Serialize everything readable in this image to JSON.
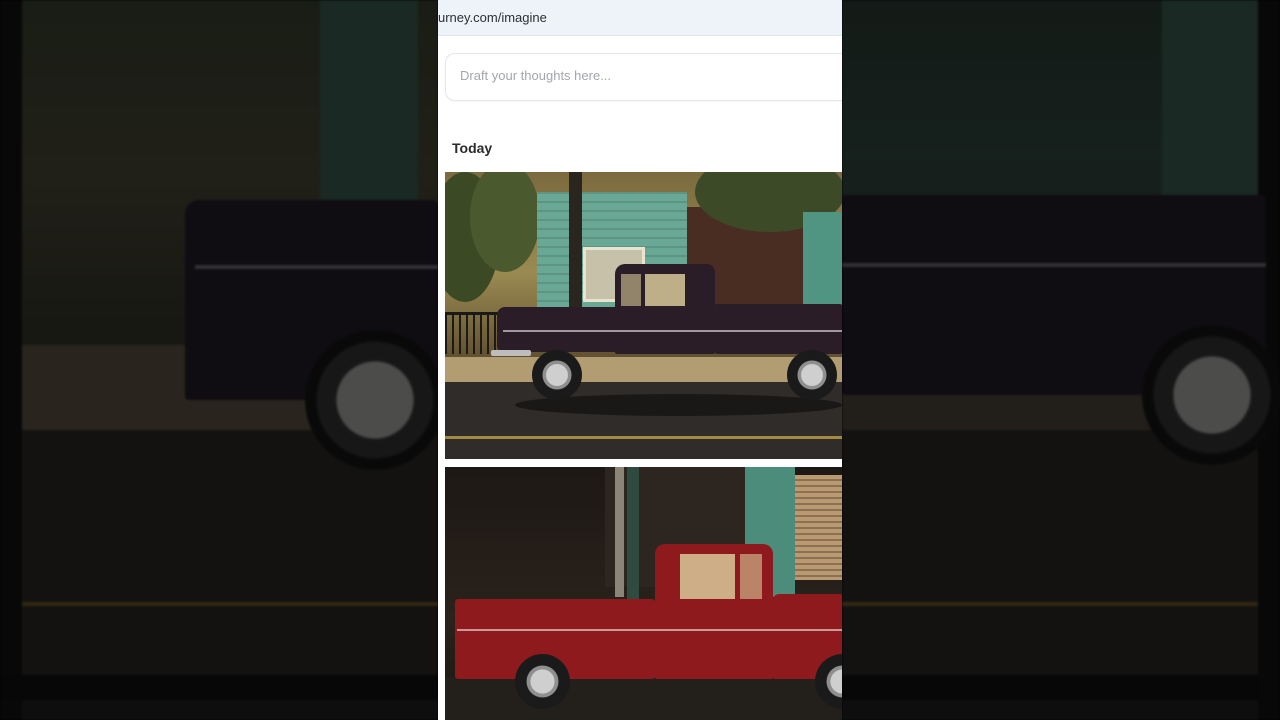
{
  "browser": {
    "url": "urney.com/imagine"
  },
  "prompt": {
    "placeholder": "Draft your thoughts here...",
    "value": ""
  },
  "feed": {
    "section_label": "Today",
    "images": [
      {
        "subject": "black vintage pickup truck on sunlit street"
      },
      {
        "subject": "red vintage pickup truck in shade"
      }
    ]
  },
  "colors": {
    "truck_black": "#2a1d27",
    "truck_red": "#8e1a1d",
    "url_bar": "#eef2f9"
  }
}
